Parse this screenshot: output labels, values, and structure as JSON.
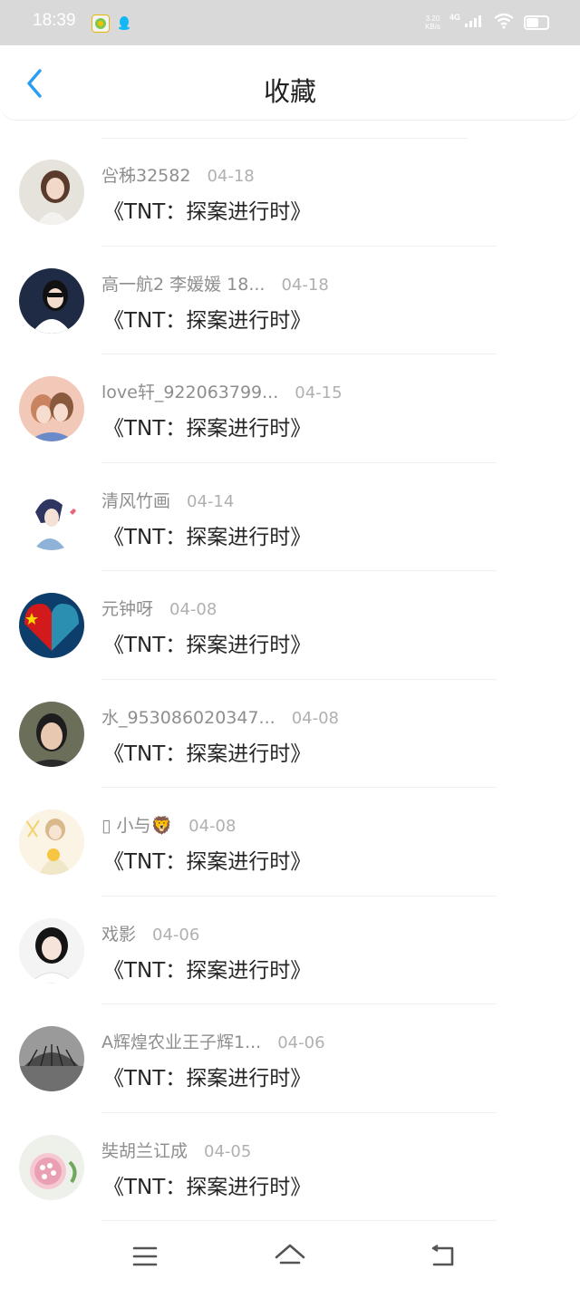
{
  "status_bar": {
    "time": "18:39",
    "net_speed_value": "3.20",
    "net_speed_unit": "KB/s",
    "net_type": "4G",
    "icons": [
      "app-notification-icon",
      "qq-icon",
      "signal-icon",
      "wifi-icon",
      "battery-icon"
    ]
  },
  "header": {
    "title": "收藏",
    "back_icon": "chevron-left-icon"
  },
  "items": [
    {
      "username": "吢秭32582",
      "date": "04-18",
      "title": "《TNT：探案进行时》"
    },
    {
      "username": "高一航2 李媛媛 18...",
      "date": "04-18",
      "title": "《TNT：探案进行时》"
    },
    {
      "username": "love轩_922063799...",
      "date": "04-15",
      "title": "《TNT：探案进行时》"
    },
    {
      "username": "清风竹画",
      "date": "04-14",
      "title": "《TNT：探案进行时》"
    },
    {
      "username": "元钟呀",
      "date": "04-08",
      "title": "《TNT：探案进行时》"
    },
    {
      "username": "水_953086020347...",
      "date": "04-08",
      "title": "《TNT：探案进行时》"
    },
    {
      "username": "▯ 小与🦁",
      "date": "04-08",
      "title": "《TNT：探案进行时》"
    },
    {
      "username": "戏影",
      "date": "04-06",
      "title": "《TNT：探案进行时》"
    },
    {
      "username": "A辉煌农业王子辉1...",
      "date": "04-06",
      "title": "《TNT：探案进行时》"
    },
    {
      "username": "奘胡兰讧成",
      "date": "04-05",
      "title": "《TNT：探案进行时》"
    }
  ],
  "nav_bar": {
    "icons": [
      "menu-icon",
      "home-icon",
      "back-icon"
    ]
  },
  "colors": {
    "status_bar_bg": "#d9d9d9",
    "accent": "#2a9df4",
    "title_text": "#222222",
    "secondary_text": "#9a9a9a"
  }
}
